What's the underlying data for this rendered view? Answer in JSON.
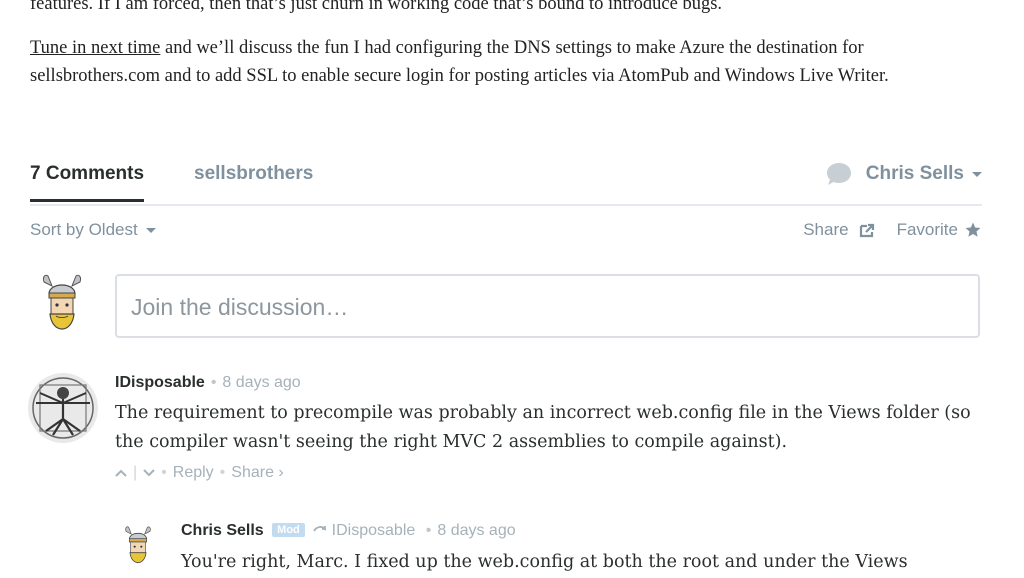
{
  "article": {
    "line1": "features. If I am forced, then that’s just churn in working code that’s bound to introduce bugs.",
    "link": "Tune in next time",
    "line2_rest": " and we’ll discuss the fun I had configuring the DNS settings to make Azure the destination for sellsbrothers.com and to add SSL to enable secure login for posting articles via AtomPub and Windows Live Writer."
  },
  "comments_header": {
    "count_label": "7 Comments",
    "site_label": "sellsbrothers",
    "user_name": "Chris Sells"
  },
  "sortbar": {
    "sort_label": "Sort by Oldest",
    "share_label": "Share",
    "favorite_label": "Favorite"
  },
  "compose": {
    "placeholder": "Join the discussion…"
  },
  "comments": [
    {
      "author": "IDisposable",
      "time": "8 days ago",
      "text": "The requirement to precompile was probably an incorrect web.config file in the Views folder (so the compiler wasn't seeing the right MVC 2 assemblies to compile against).",
      "reply_label": "Reply",
      "share_label": "Share ›"
    },
    {
      "author": "Chris Sells",
      "badge": "Mod",
      "reply_to": "IDisposable",
      "time": "8 days ago",
      "text": "You're right, Marc. I fixed up the web.config at both the root and under the Views"
    }
  ],
  "colors": {
    "text": "#2a2e2e",
    "muted": "#7f919e",
    "meta": "#a5b2b9",
    "mod_badge": "#c2dbf0"
  }
}
